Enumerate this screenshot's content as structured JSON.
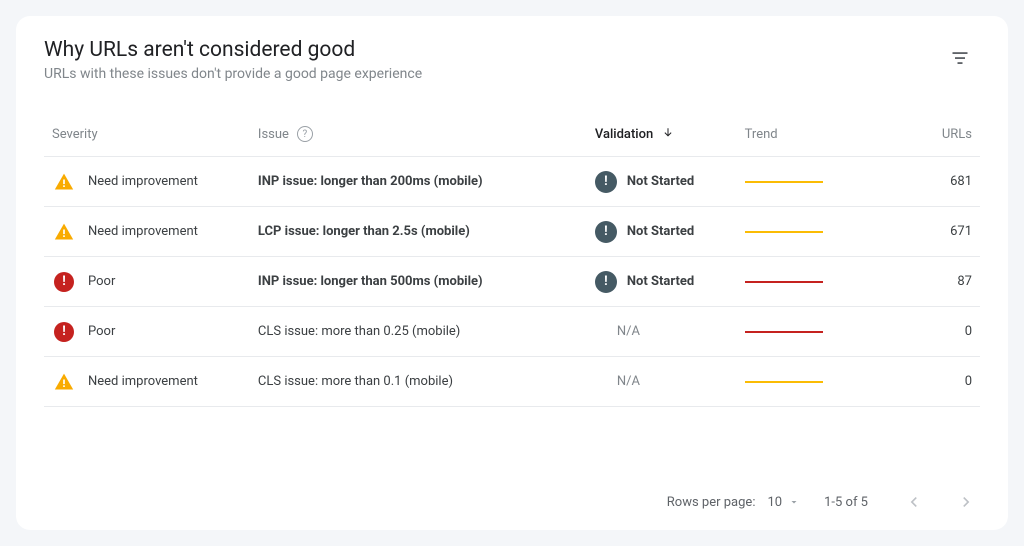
{
  "header": {
    "title": "Why URLs aren't considered good",
    "subtitle": "URLs with these issues don't provide a good page experience"
  },
  "columns": {
    "severity": "Severity",
    "issue": "Issue",
    "validation": "Validation",
    "trend": "Trend",
    "urls": "URLs"
  },
  "rows": [
    {
      "severity_type": "need",
      "severity": "Need improvement",
      "issue": "INP issue: longer than 200ms (mobile)",
      "issue_bold": true,
      "validation_type": "not_started",
      "validation": "Not Started",
      "trend": "orange",
      "urls": "681"
    },
    {
      "severity_type": "need",
      "severity": "Need improvement",
      "issue": "LCP issue: longer than 2.5s (mobile)",
      "issue_bold": true,
      "validation_type": "not_started",
      "validation": "Not Started",
      "trend": "orange",
      "urls": "671"
    },
    {
      "severity_type": "poor",
      "severity": "Poor",
      "issue": "INP issue: longer than 500ms (mobile)",
      "issue_bold": true,
      "validation_type": "not_started",
      "validation": "Not Started",
      "trend": "red",
      "urls": "87"
    },
    {
      "severity_type": "poor",
      "severity": "Poor",
      "issue": "CLS issue: more than 0.25 (mobile)",
      "issue_bold": false,
      "validation_type": "na",
      "validation": "N/A",
      "trend": "red",
      "urls": "0"
    },
    {
      "severity_type": "need",
      "severity": "Need improvement",
      "issue": "CLS issue: more than 0.1 (mobile)",
      "issue_bold": false,
      "validation_type": "na",
      "validation": "N/A",
      "trend": "orange",
      "urls": "0"
    }
  ],
  "pagination": {
    "rows_label": "Rows per page:",
    "rows_value": "10",
    "range": "1-5 of 5"
  }
}
